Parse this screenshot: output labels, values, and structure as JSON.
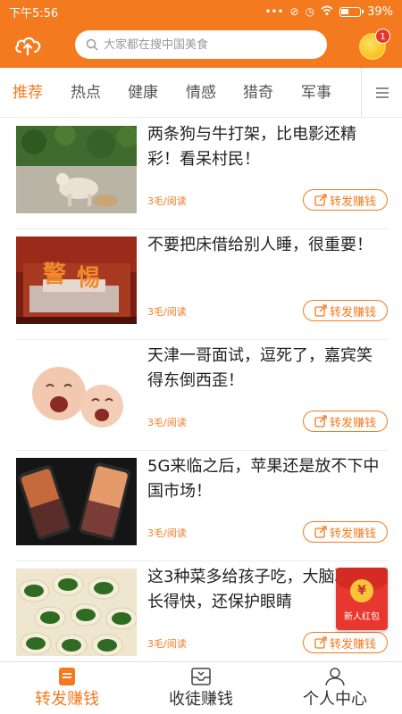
{
  "status_bar": {
    "time": "下午5:56",
    "battery": "39%"
  },
  "header": {
    "search_placeholder": "大家都在搜中国美食",
    "coin_badge": "1"
  },
  "tabs": [
    {
      "label": "推荐",
      "active": true
    },
    {
      "label": "热点",
      "active": false
    },
    {
      "label": "健康",
      "active": false
    },
    {
      "label": "情感",
      "active": false
    },
    {
      "label": "猎奇",
      "active": false
    },
    {
      "label": "军事",
      "active": false
    }
  ],
  "feed": [
    {
      "title": "两条狗与牛打架，比电影还精彩！看呆村民！",
      "price": "3毛/阅读",
      "button": "转发赚钱",
      "thumb": "dogs-and-cow-photo"
    },
    {
      "title": "不要把床借给别人睡，很重要！",
      "price": "3毛/阅读",
      "button": "转发赚钱",
      "thumb": "bed-warning-photo"
    },
    {
      "title": "天津一哥面试，逗死了，嘉宾笑得东倒西歪！",
      "price": "3毛/阅读",
      "button": "转发赚钱",
      "thumb": "crying-babies-photo"
    },
    {
      "title": "5G来临之后，苹果还是放不下中国市场！",
      "price": "3毛/阅读",
      "button": "转发赚钱",
      "thumb": "smartphones-photo"
    },
    {
      "title": "这3种菜多给孩子吃，大脑聪明，长得快，还保护眼睛",
      "price": "3毛/阅读",
      "button": "转发赚钱",
      "thumb": "spinach-food-photo"
    }
  ],
  "red_packet": {
    "label": "新人红包",
    "symbol": "¥"
  },
  "bottom_nav": [
    {
      "label": "转发赚钱",
      "icon": "share-doc-icon",
      "active": true
    },
    {
      "label": "收徒赚钱",
      "icon": "inbox-icon",
      "active": false
    },
    {
      "label": "个人中心",
      "icon": "person-icon",
      "active": false
    }
  ],
  "colors": {
    "brand_orange": "#f47a1f",
    "red_packet": "#e8372e",
    "badge_red": "#e8362c"
  }
}
